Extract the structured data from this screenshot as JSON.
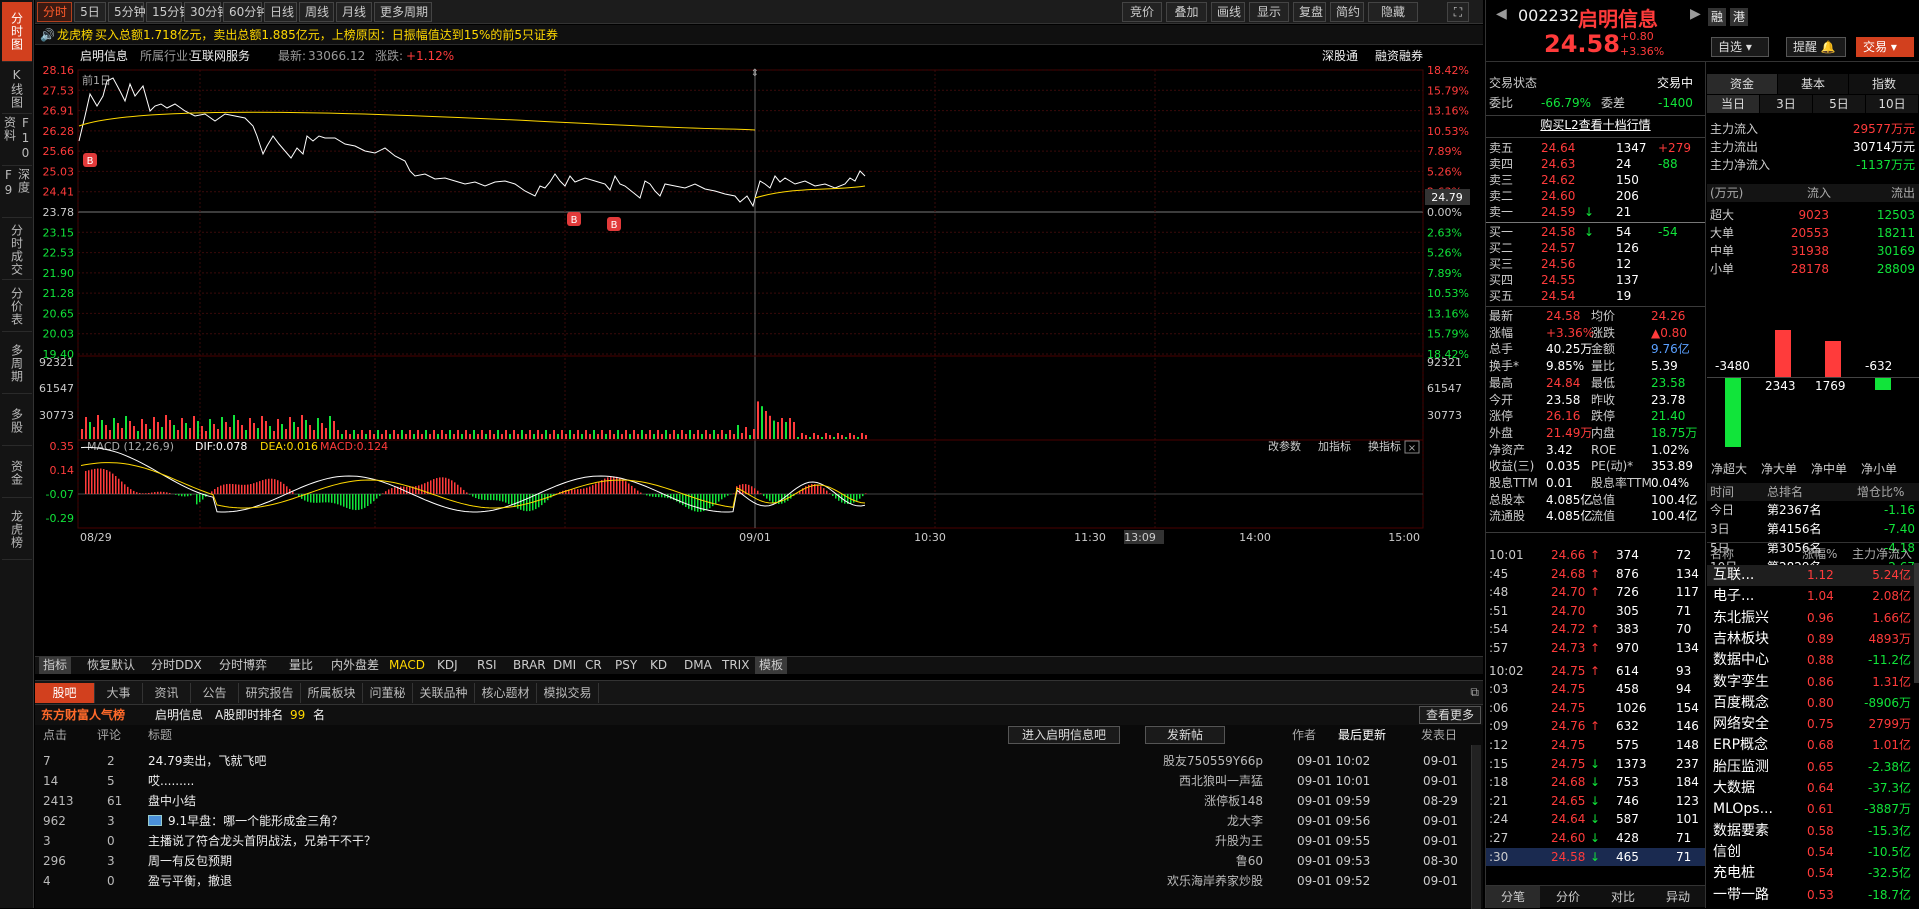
{
  "left_tabs": [
    "分时图",
    "K线图",
    "F10资料",
    "深度F9",
    "分时成交",
    "分价表",
    "多周期",
    "多股",
    "资金",
    "龙虎榜"
  ],
  "toolbar": {
    "periods": [
      "分时",
      "5日",
      "5分钟",
      "15分钟",
      "30分钟",
      "60分钟",
      "日线",
      "周线",
      "月线",
      "更多周期"
    ],
    "right": [
      "竞价",
      "叠加",
      "画线",
      "显示",
      "复盘",
      "简约",
      "隐藏"
    ]
  },
  "lhb": {
    "label": "龙虎榜",
    "text": "买入总额1.718亿元，卖出总额1.885亿元，上榜原因：日振幅值达到15%的前5只证券"
  },
  "info": {
    "name": "启明信息",
    "industry_label": "所属行业:",
    "industry": "互联网服务",
    "latest_label": "最新:",
    "latest": "33066.12",
    "chg_label": "涨跌:",
    "chg": "+1.12%",
    "sgt": "深股通",
    "rzrq": "融资融券"
  },
  "chart": {
    "prev_label": "前1日",
    "price_ticks": [
      "28.16",
      "27.53",
      "26.91",
      "26.28",
      "25.66",
      "25.03",
      "24.41",
      "23.78",
      "23.15",
      "22.53",
      "21.90",
      "21.28",
      "20.65",
      "20.03",
      "19.40"
    ],
    "pct_ticks": [
      "18.42%",
      "15.79%",
      "13.16%",
      "10.53%",
      "7.89%",
      "5.26%",
      "2.63%",
      "0.00%",
      "2.63%",
      "5.26%",
      "7.89%",
      "10.53%",
      "13.16%",
      "15.79%",
      "18.42%"
    ],
    "cur_price": "24.79",
    "vol_ticks": [
      "92321",
      "61547",
      "30773"
    ],
    "macd_ticks": [
      "0.35",
      "0.14",
      "-0.07",
      "-0.29"
    ],
    "macd_label": "MACD (12,26,9)",
    "dif": "DIF:0.078",
    "dea": "DEA:0.016",
    "macd": "MACD:0.124",
    "macd_btns": [
      "改参数",
      "加指标",
      "换指标"
    ],
    "time_labels": [
      "08/29",
      "09/01",
      "10:30",
      "11:30",
      "13:09",
      "14:00",
      "15:00"
    ],
    "bmarks": [
      "B",
      "B",
      "B"
    ]
  },
  "indicator_tabs": [
    "指标",
    "恢复默认",
    "分时DDX",
    "分时博弈",
    "量比",
    "内外盘差",
    "MACD",
    "KDJ",
    "RSI",
    "BRAR",
    "DMI",
    "CR",
    "PSY",
    "KD",
    "DMA",
    "TRIX",
    "模板"
  ],
  "guba": {
    "tabs": [
      "股吧",
      "大事",
      "资讯",
      "公告",
      "研究报告",
      "所属板块",
      "问董秘",
      "关联品种",
      "核心题材",
      "模拟交易"
    ],
    "brand": "东方财富人气榜",
    "stock": "启明信息",
    "rank_label": "A股即时排名",
    "rank": "99",
    "rank_unit": "名",
    "more": "查看更多",
    "headers": [
      "点击",
      "评论",
      "标题",
      "作者",
      "最后更新",
      "发表日"
    ],
    "btn_enter": "进入启明信息吧",
    "btn_post": "发新帖",
    "posts": [
      [
        "7",
        "2",
        "24.79卖出，飞就飞吧",
        "股友750559Y66p",
        "09-01 10:02",
        "09-01"
      ],
      [
        "14",
        "5",
        "哎.........",
        "西北狼叫一声猛",
        "09-01 10:01",
        "09-01"
      ],
      [
        "2413",
        "61",
        "盘中小结",
        "涨停板148",
        "09-01 09:59",
        "08-29"
      ],
      [
        "962",
        "3",
        "9.1早盘：哪一个能形成金三角？",
        "龙大李",
        "09-01 09:56",
        "09-01"
      ],
      [
        "3",
        "0",
        "主播说了符合龙头首阴战法，兄弟干不干？",
        "升股为王",
        "09-01 09:55",
        "09-01"
      ],
      [
        "296",
        "3",
        "周一有反包预期",
        "鲁60",
        "09-01 09:53",
        "08-30"
      ],
      [
        "4",
        "0",
        "盈亏平衡，撤退",
        "欢乐海岸养家炒股",
        "09-01 09:52",
        "09-01"
      ]
    ]
  },
  "stock": {
    "code": "002232",
    "name": "启明信息",
    "rz": "融",
    "gang": "港",
    "price": "24.58",
    "chg": "+0.80",
    "pct": "+3.36%",
    "zixuan": "自选",
    "tixing": "提醒",
    "jiaoyi": "交易"
  },
  "trade": {
    "status_label": "交易状态",
    "status": "交易中",
    "wb_label": "委比",
    "wb": "-66.79%",
    "wc_label": "委差",
    "wc": "-1400",
    "buy_l2": "购买L2查看十档行情",
    "asks": [
      [
        "卖五",
        "24.64",
        "1347",
        "+279"
      ],
      [
        "卖四",
        "24.63",
        "24",
        "-88"
      ],
      [
        "卖三",
        "24.62",
        "150",
        ""
      ],
      [
        "卖二",
        "24.60",
        "206",
        ""
      ],
      [
        "卖一",
        "24.59",
        "21",
        ""
      ]
    ],
    "bids": [
      [
        "买一",
        "24.58",
        "54",
        "-54"
      ],
      [
        "买二",
        "24.57",
        "126",
        ""
      ],
      [
        "买三",
        "24.56",
        "12",
        ""
      ],
      [
        "买四",
        "24.55",
        "137",
        ""
      ],
      [
        "买五",
        "24.54",
        "19",
        ""
      ]
    ],
    "stats": [
      [
        "最新",
        "24.58",
        "均价",
        "24.26"
      ],
      [
        "涨幅",
        "+3.36%",
        "涨跌",
        "▲0.80"
      ],
      [
        "总手",
        "40.25万",
        "金额",
        "9.76亿"
      ],
      [
        "换手*",
        "9.85%",
        "量比",
        "5.39"
      ],
      [
        "最高",
        "24.84",
        "最低",
        "23.58"
      ],
      [
        "今开",
        "23.58",
        "昨收",
        "23.78"
      ],
      [
        "涨停",
        "26.16",
        "跌停",
        "21.40"
      ],
      [
        "外盘",
        "21.49万",
        "内盘",
        "18.75万"
      ],
      [
        "净资产",
        "3.42",
        "ROE",
        "1.02%"
      ],
      [
        "收益(三)",
        "0.035",
        "PE(动)*",
        "353.89"
      ],
      [
        "股息TTM",
        "0.01",
        "股息率TTM",
        "0.04%"
      ],
      [
        "总股本",
        "4.085亿",
        "总值",
        "100.4亿"
      ],
      [
        "流通股",
        "4.085亿",
        "流值",
        "100.4亿"
      ]
    ]
  },
  "ticks": [
    [
      "10:01",
      "24.66",
      "374",
      "72"
    ],
    [
      ":45",
      "24.68",
      "876",
      "134"
    ],
    [
      ":48",
      "24.70",
      "726",
      "117"
    ],
    [
      ":51",
      "24.70",
      "305",
      "71"
    ],
    [
      ":54",
      "24.72",
      "383",
      "70"
    ],
    [
      ":57",
      "24.73",
      "970",
      "134"
    ],
    [
      "10:02",
      "24.75",
      "614",
      "93"
    ],
    [
      ":03",
      "24.75",
      "458",
      "94"
    ],
    [
      ":06",
      "24.75",
      "1026",
      "154"
    ],
    [
      ":09",
      "24.76",
      "632",
      "146"
    ],
    [
      ":12",
      "24.75",
      "575",
      "148"
    ],
    [
      ":15",
      "24.75",
      "1373",
      "237"
    ],
    [
      ":18",
      "24.68",
      "753",
      "184"
    ],
    [
      ":21",
      "24.65",
      "746",
      "123"
    ],
    [
      ":24",
      "24.64",
      "587",
      "101"
    ],
    [
      ":27",
      "24.60",
      "428",
      "71"
    ],
    [
      ":30",
      "24.58",
      "465",
      "71"
    ]
  ],
  "tick_tabs": [
    "分笔",
    "分价",
    "对比",
    "异动"
  ],
  "fund": {
    "tabs": [
      "资金",
      "基本",
      "指数"
    ],
    "subtabs": [
      "当日",
      "3日",
      "5日",
      "10日"
    ],
    "main": [
      [
        "主力流入",
        "29577万元"
      ],
      [
        "主力流出",
        "30714万元"
      ],
      [
        "主力净流入",
        "-1137万元"
      ]
    ],
    "unit": "(万元)",
    "in_label": "流入",
    "out_label": "流出",
    "rows": [
      [
        "超大",
        "9023",
        "12503"
      ],
      [
        "大单",
        "20553",
        "18211"
      ],
      [
        "中单",
        "31938",
        "30169"
      ],
      [
        "小单",
        "28178",
        "28809"
      ]
    ],
    "net_values": [
      -3480,
      2343,
      1769,
      -632
    ],
    "net_labels": [
      "净超大",
      "净大单",
      "净中单",
      "净小单"
    ],
    "rank_headers": [
      "时间",
      "总排名",
      "增仓比%"
    ],
    "rank": [
      [
        "今日",
        "第2367名",
        "-1.16"
      ],
      [
        "3日",
        "第4156名",
        "-7.40"
      ],
      [
        "5日",
        "第3056名",
        "-4.18"
      ],
      [
        "10日",
        "第2829名",
        "-2.67"
      ]
    ]
  },
  "sectors": {
    "headers": [
      "名称",
      "涨幅%",
      "主力净流入"
    ],
    "rows": [
      [
        "互联...",
        "1.12",
        "5.24亿"
      ],
      [
        "电子...",
        "1.04",
        "2.08亿"
      ],
      [
        "东北振兴",
        "0.96",
        "1.66亿"
      ],
      [
        "吉林板块",
        "0.89",
        "4893万"
      ],
      [
        "数据中心",
        "0.88",
        "-11.2亿"
      ],
      [
        "数字孪生",
        "0.86",
        "1.31亿"
      ],
      [
        "百度概念",
        "0.80",
        "-8906万"
      ],
      [
        "网络安全",
        "0.75",
        "2799万"
      ],
      [
        "ERP概念",
        "0.68",
        "1.01亿"
      ],
      [
        "胎压监测",
        "0.65",
        "-2.38亿"
      ],
      [
        "大数据",
        "0.64",
        "-37.3亿"
      ],
      [
        "MLOps...",
        "0.61",
        "-3887万"
      ],
      [
        "数据要素",
        "0.58",
        "-15.3亿"
      ],
      [
        "信创",
        "0.54",
        "-10.5亿"
      ],
      [
        "充电桩",
        "0.54",
        "-32.5亿"
      ],
      [
        "一带一路",
        "0.53",
        "-18.7亿"
      ]
    ]
  },
  "colors": {
    "up": "#ff3b3b",
    "down": "#11e43a",
    "accent": "#d2401e",
    "avg": "#ffd800",
    "price": "#ffffff"
  }
}
